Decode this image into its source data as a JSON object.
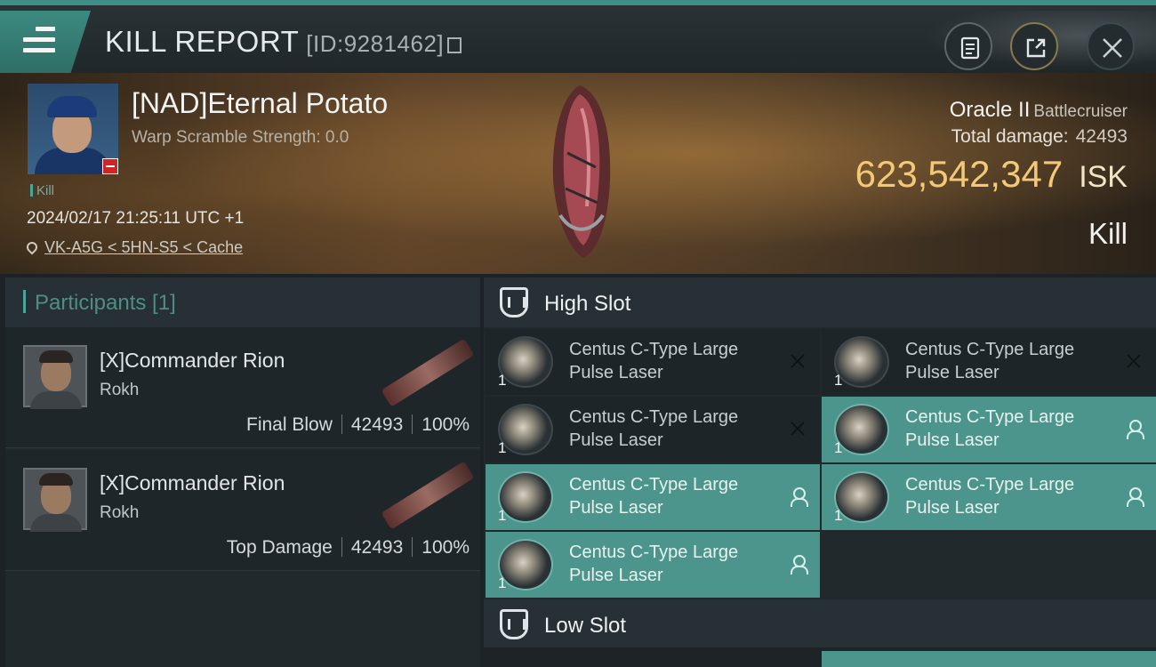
{
  "titlebar": {
    "title": "KILL REPORT",
    "id_label": "[ID:9281462]"
  },
  "victim": {
    "name": "[NAD]Eternal Potato",
    "warp_scramble": "Warp Scramble Strength: 0.0",
    "tag": "Kill",
    "datetime": "2024/02/17 21:25:11 UTC +1",
    "location": "VK-A5G < 5HN-S5 < Cache"
  },
  "ship": {
    "name": "Oracle II",
    "class": "Battlecruiser",
    "total_damage_label": "Total damage:",
    "total_damage_value": "42493",
    "isk_value": "623,542,347",
    "isk_unit": "ISK",
    "result": "Kill"
  },
  "participants": {
    "header": "Participants [1]",
    "rows": [
      {
        "name": "[X]Commander Rion",
        "ship": "Rokh",
        "role": "Final Blow",
        "damage": "42493",
        "percent": "100%"
      },
      {
        "name": "[X]Commander Rion",
        "ship": "Rokh",
        "role": "Top Damage",
        "damage": "42493",
        "percent": "100%"
      }
    ]
  },
  "high_slot": {
    "label": "High Slot",
    "modules": [
      {
        "line1": "Centus C-Type Large",
        "line2": "Pulse Laser",
        "qty": "1",
        "status": "destroyed"
      },
      {
        "line1": "Centus C-Type Large",
        "line2": "Pulse Laser",
        "qty": "1",
        "status": "destroyed"
      },
      {
        "line1": "Centus C-Type Large",
        "line2": "Pulse Laser",
        "qty": "1",
        "status": "destroyed"
      },
      {
        "line1": "Centus C-Type Large",
        "line2": "Pulse Laser",
        "qty": "1",
        "status": "dropped"
      },
      {
        "line1": "Centus C-Type Large",
        "line2": "Pulse Laser",
        "qty": "1",
        "status": "dropped"
      },
      {
        "line1": "Centus C-Type Large",
        "line2": "Pulse Laser",
        "qty": "1",
        "status": "dropped"
      },
      {
        "line1": "Centus C-Type Large",
        "line2": "Pulse Laser",
        "qty": "1",
        "status": "dropped"
      }
    ]
  },
  "low_slot": {
    "label": "Low Slot"
  },
  "colors": {
    "accent": "#4c958c",
    "isk": "#f3c978"
  },
  "icons": [
    "menu-icon",
    "copy-icon",
    "clipboard-icon",
    "share-icon",
    "close-icon",
    "location-pin-icon",
    "shield-icon",
    "x-icon",
    "person-icon"
  ]
}
